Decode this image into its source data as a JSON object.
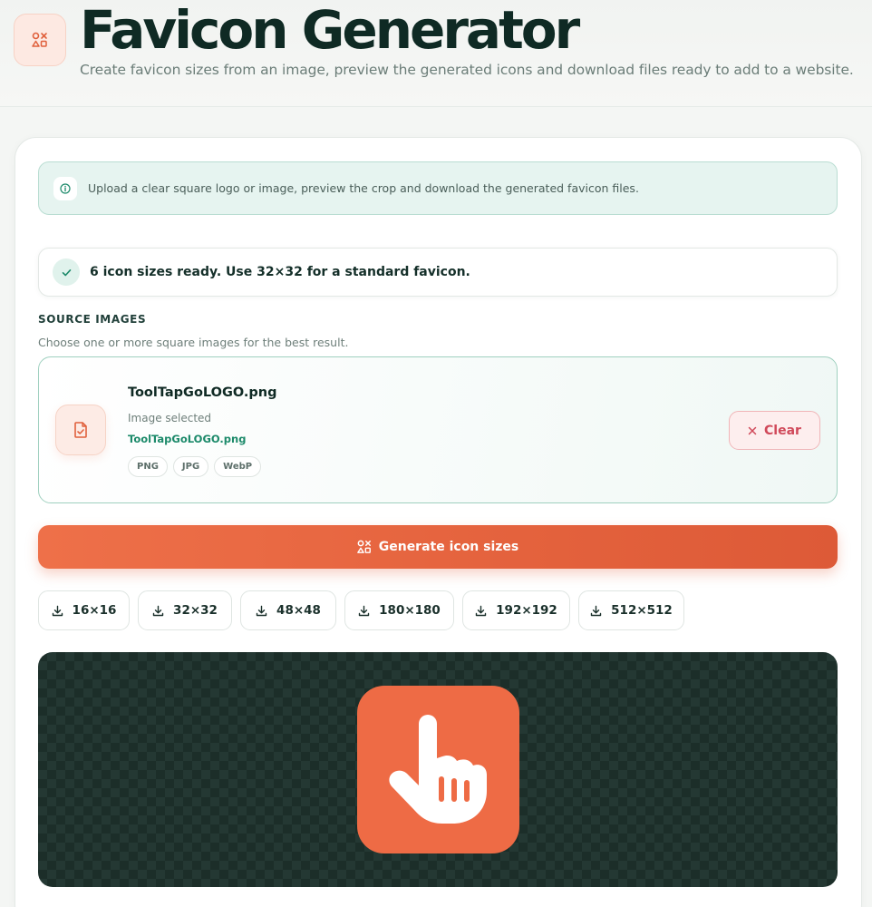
{
  "header": {
    "logo_icon": "shapes-icon",
    "title": "Favicon Generator",
    "subtitle": "Create favicon sizes from an image, preview the generated icons and download files ready to add to a website."
  },
  "info": {
    "icon": "info-icon",
    "text": "Upload a clear square logo or image, preview the crop and download the generated favicon files."
  },
  "status": {
    "icon": "check-icon",
    "text": "6 icon sizes ready. Use 32×32 for a standard favicon."
  },
  "source": {
    "label": "SOURCE IMAGES",
    "hint": "Choose one or more square images for the best result.",
    "file_name": "ToolTapGoLOGO.png",
    "file_status": "Image selected",
    "file_link": "ToolTapGoLOGO.png",
    "formats": [
      "PNG",
      "JPG",
      "WebP"
    ],
    "clear_label": "Clear"
  },
  "generate": {
    "label": "Generate icon sizes"
  },
  "sizes": [
    {
      "label": "16×16"
    },
    {
      "label": "32×32"
    },
    {
      "label": "48×48"
    },
    {
      "label": "180×180"
    },
    {
      "label": "192×192"
    },
    {
      "label": "512×512"
    }
  ],
  "colors": {
    "accent": "#ee6b45",
    "brand_dark": "#0f2a24",
    "success": "#1c8a6a",
    "danger": "#d0495a"
  }
}
